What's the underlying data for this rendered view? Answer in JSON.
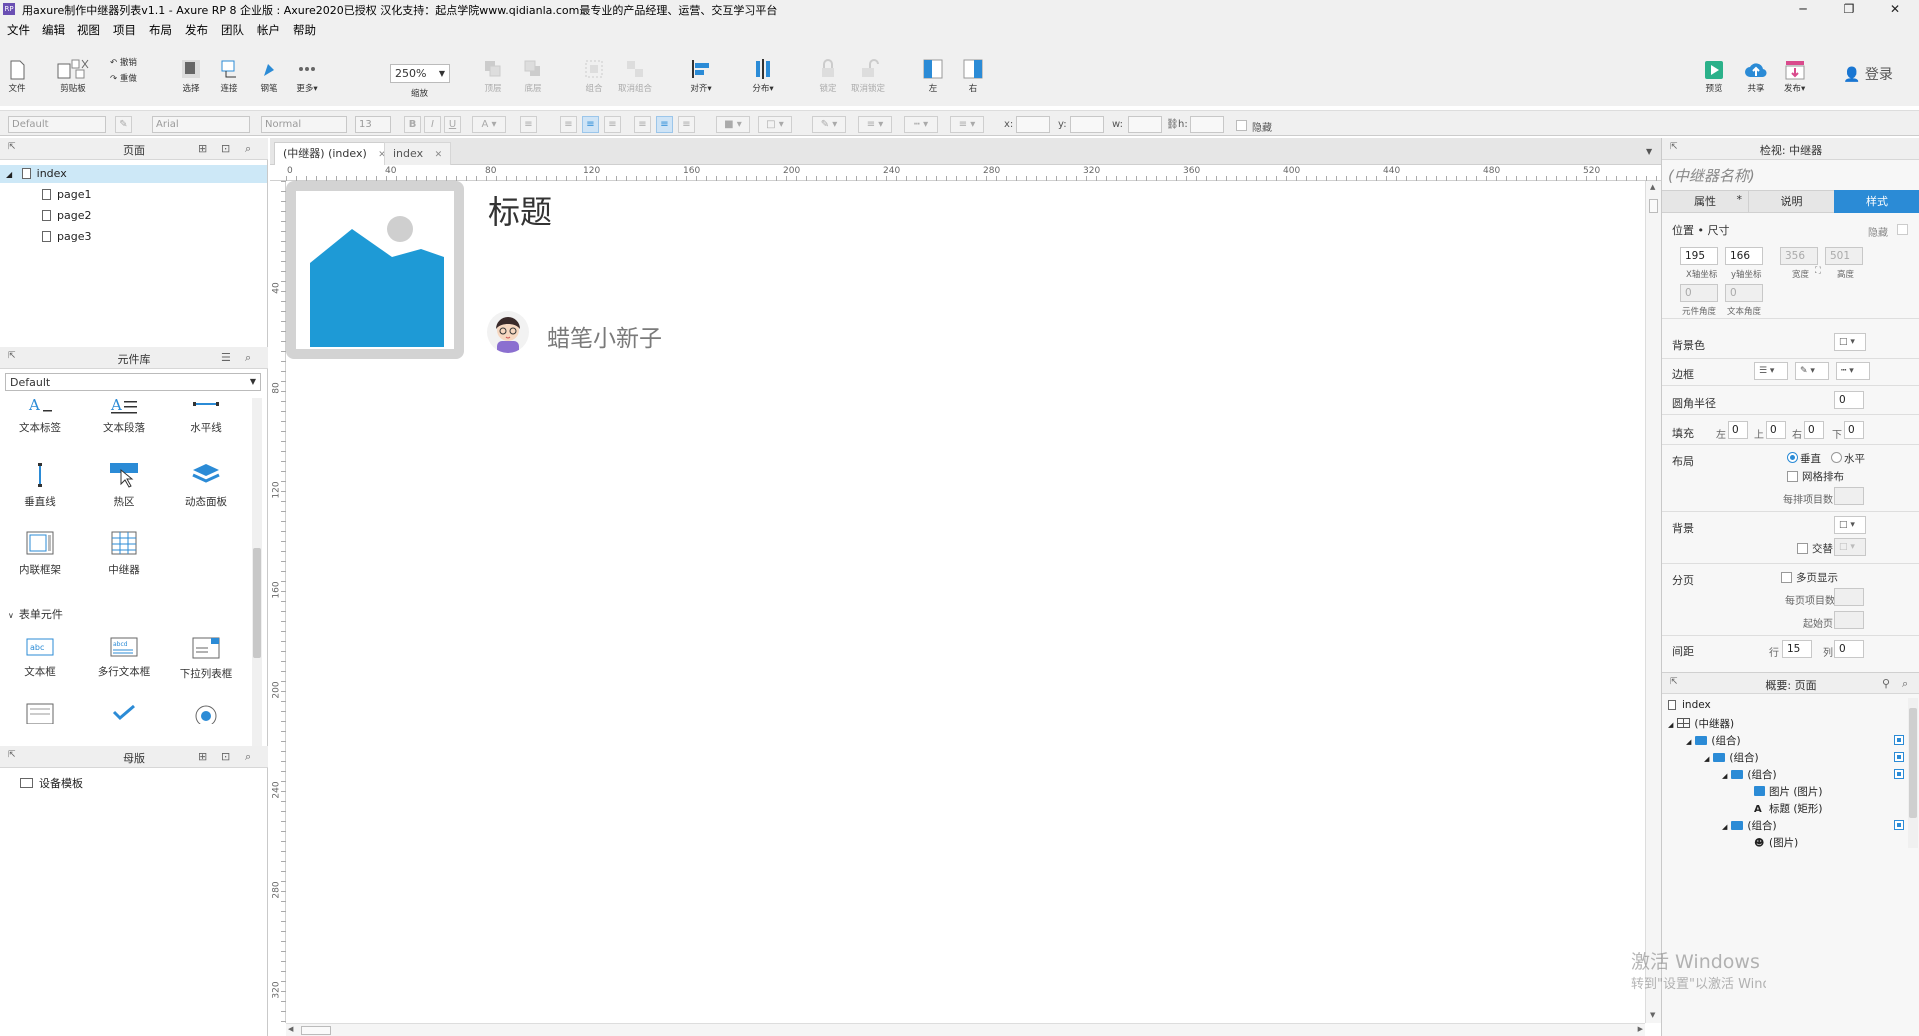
{
  "app": {
    "title": "用axure制作中继器列表v1.1 - Axure RP 8 企业版 : Axure2020已授权 汉化支持：起点学院www.qidianla.com最专业的产品经理、运营、交互学习平台",
    "logo_text": "RP"
  },
  "window_controls": {
    "minimize": "─",
    "maximize": "❐",
    "close": "✕"
  },
  "menu": [
    "文件",
    "编辑",
    "视图",
    "项目",
    "布局",
    "发布",
    "团队",
    "帐户",
    "帮助"
  ],
  "toolbar": {
    "file": "文件",
    "clipboard": "剪贴板",
    "undo": "撤销",
    "redo": "重做",
    "select": "选择",
    "connect": "连接",
    "pen": "钢笔",
    "more": "更多▾",
    "zoom_value": "250%",
    "zoom": "缩放",
    "top": "顶层",
    "bottom": "底层",
    "group": "组合",
    "ungroup": "取消组合",
    "align": "对齐▾",
    "distribute": "分布▾",
    "lock": "锁定",
    "unlock": "取消锁定",
    "left": "左",
    "right": "右",
    "preview": "预览",
    "share": "共享",
    "publish": "发布▾",
    "login": "登录"
  },
  "format_bar": {
    "style": "Default",
    "font": "Arial",
    "weight": "Normal",
    "size": "13",
    "x_label": "x:",
    "y_label": "y:",
    "w_label": "w:",
    "h_label": "h:",
    "hidden": "隐藏"
  },
  "pages_panel": {
    "title": "页面",
    "root": "index",
    "pages": [
      "page1",
      "page2",
      "page3"
    ]
  },
  "library_panel": {
    "title": "元件库",
    "selected": "Default",
    "widgets": [
      "文本标签",
      "文本段落",
      "水平线",
      "垂直线",
      "热区",
      "动态面板",
      "内联框架",
      "中继器"
    ],
    "form_section": "表单元件",
    "form_widgets": [
      "文本框",
      "多行文本框",
      "下拉列表框"
    ]
  },
  "masters_panel": {
    "title": "母版",
    "items": [
      "设备模板"
    ]
  },
  "tabs": [
    {
      "label": "(中继器) (index)",
      "close": "✕"
    },
    {
      "label": "index",
      "close": "✕"
    }
  ],
  "ruler": {
    "h": [
      "0",
      "40",
      "80",
      "120",
      "160",
      "200",
      "240",
      "280",
      "320",
      "360",
      "400",
      "440",
      "480",
      "520"
    ],
    "v": [
      "40",
      "80",
      "120",
      "160",
      "200",
      "240",
      "280",
      "320"
    ]
  },
  "canvas": {
    "heading": "标题",
    "author": "蜡笔小新子",
    "colors": {
      "image_fill": "#1e9ad6",
      "frame": "#cfcfcf"
    }
  },
  "inspector": {
    "title": "检视: 中继器",
    "name_placeholder": "(中继器名称)",
    "tabs": [
      "属性",
      "说明",
      "样式"
    ],
    "tab_marker": "*",
    "position_size": "位置 • 尺寸",
    "hidden": "隐藏",
    "x": "195",
    "y": "166",
    "w": "356",
    "h": "501",
    "x_label": "X轴坐标",
    "y_label": "y轴坐标",
    "w_label": "宽度",
    "h_label": "高度",
    "rot": "0",
    "text_rot": "0",
    "rot_label": "元件角度",
    "text_rot_label": "文本角度",
    "bg_color": "背景色",
    "border": "边框",
    "radius": "圆角半径",
    "radius_value": "0",
    "padding": "填充",
    "pad_left": "左",
    "pad_top": "上",
    "pad_right": "右",
    "pad_bottom": "下",
    "pad_values": [
      "0",
      "0",
      "0",
      "0"
    ],
    "layout": "布局",
    "vertical": "垂直",
    "horizontal": "水平",
    "grid": "网格排布",
    "per_row": "每排项目数",
    "background": "背景",
    "alternate": "交替",
    "paging": "分页",
    "multi_page": "多页显示",
    "per_page": "每页项目数",
    "start_page": "起始页",
    "spacing": "间距",
    "row_label": "行",
    "row_value": "15",
    "col_label": "列",
    "col_value": "0",
    "accent": "#2b8bd6"
  },
  "outline": {
    "title": "概要: 页面",
    "items": [
      "index",
      "(中继器)",
      "(组合)",
      "(组合)",
      "(组合)",
      "图片 (图片)",
      "标题 (矩形)",
      "(组合)",
      "(图片)"
    ]
  },
  "watermark": {
    "line1": "激活 Windows",
    "line2": "转到\"设置\"以激活 Windows。"
  }
}
